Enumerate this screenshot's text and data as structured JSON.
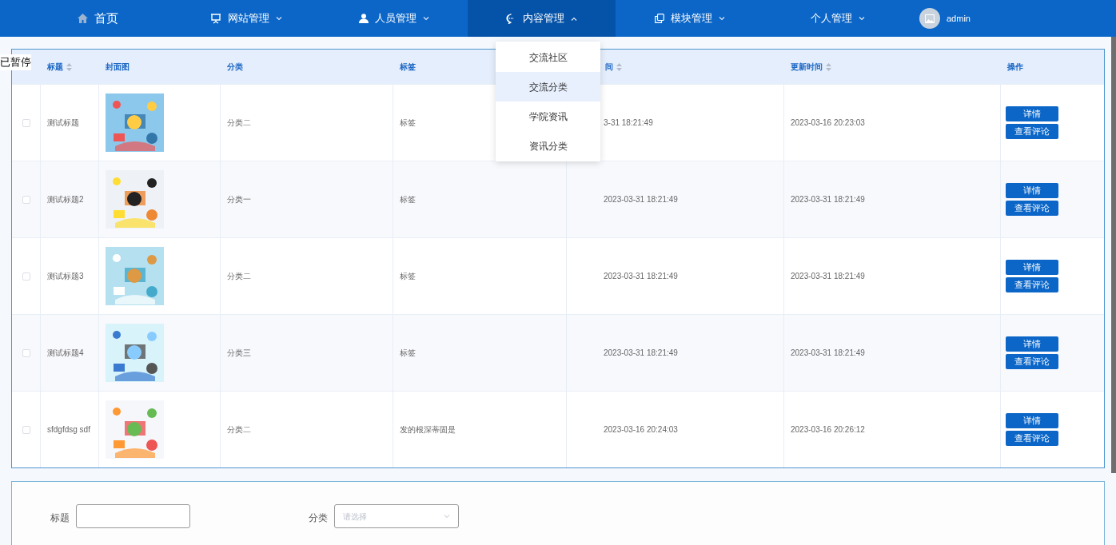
{
  "overlay_label": "已暂停",
  "nav": {
    "items": [
      {
        "label": "首页",
        "kind": "home",
        "dropdown": false,
        "selected": false
      },
      {
        "label": "网站管理",
        "kind": "board",
        "dropdown": true,
        "selected": false
      },
      {
        "label": "人员管理",
        "kind": "user",
        "dropdown": true,
        "selected": false
      },
      {
        "label": "内容管理",
        "kind": "chat",
        "dropdown": true,
        "selected": true
      },
      {
        "label": "模块管理",
        "kind": "copy",
        "dropdown": true,
        "selected": false
      },
      {
        "label": "个人管理",
        "kind": "none",
        "dropdown": true,
        "selected": false
      }
    ],
    "user": "admin",
    "menu": [
      {
        "label": "交流社区",
        "highlighted": false
      },
      {
        "label": "交流分类",
        "highlighted": true
      },
      {
        "label": "学院资讯",
        "highlighted": false
      },
      {
        "label": "资讯分类",
        "highlighted": false
      }
    ]
  },
  "table": {
    "columns": [
      {
        "label": "标题",
        "sortable": true
      },
      {
        "label": "封面图",
        "sortable": false
      },
      {
        "label": "分类",
        "sortable": false
      },
      {
        "label": "标签",
        "sortable": false
      },
      {
        "label": "间",
        "sortable": true
      },
      {
        "label": "更新时间",
        "sortable": true
      },
      {
        "label": "操作",
        "sortable": false
      }
    ],
    "rows": [
      {
        "checked": false,
        "title": "测试标题",
        "category": "分类二",
        "tag": "标签",
        "created": "3-31 18:21:49",
        "updated": "2023-03-16 20:23:03",
        "actions": [
          "详情",
          "查看评论"
        ]
      },
      {
        "checked": false,
        "title": "测试标题2",
        "category": "分类一",
        "tag": "标签",
        "created": "2023-03-31 18:21:49",
        "updated": "2023-03-31 18:21:49",
        "actions": [
          "详情",
          "查看评论"
        ]
      },
      {
        "checked": false,
        "title": "测试标题3",
        "category": "分类二",
        "tag": "标签",
        "created": "2023-03-31 18:21:49",
        "updated": "2023-03-31 18:21:49",
        "actions": [
          "详情",
          "查看评论"
        ]
      },
      {
        "checked": false,
        "title": "测试标题4",
        "category": "分类三",
        "tag": "标签",
        "created": "2023-03-31 18:21:49",
        "updated": "2023-03-31 18:21:49",
        "actions": [
          "详情",
          "查看评论"
        ]
      },
      {
        "checked": false,
        "title": "sfdgfdsg sdf",
        "category": "分类二",
        "tag": "发的根深蒂固是",
        "created": "2023-03-16 20:24:03",
        "updated": "2023-03-16 20:26:12",
        "actions": [
          "详情",
          "查看评论"
        ]
      }
    ]
  },
  "form": {
    "title_label": "标题",
    "category_label": "分类",
    "category_placeholder": "请选择"
  }
}
